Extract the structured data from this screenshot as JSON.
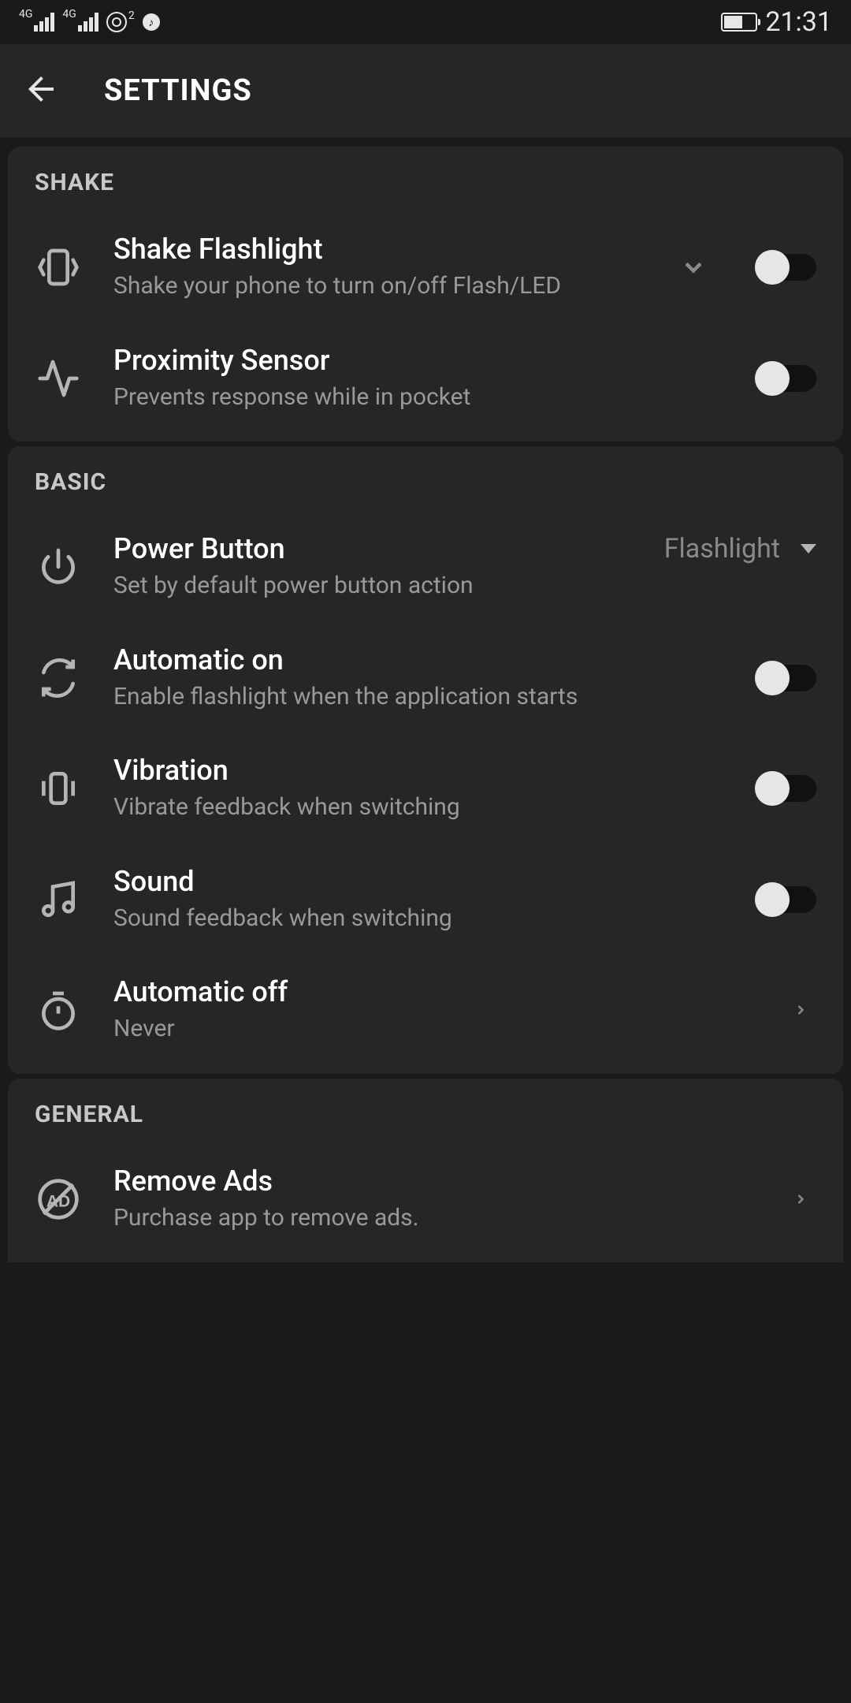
{
  "status": {
    "net_label": "4G",
    "hotspot_count": "2",
    "time": "21:31"
  },
  "header": {
    "title": "SETTINGS"
  },
  "sections": {
    "shake": {
      "header": "SHAKE",
      "shake_flashlight": {
        "title": "Shake Flashlight",
        "sub": "Shake your phone to turn on/off Flash/LED"
      },
      "proximity": {
        "title": "Proximity Sensor",
        "sub": "Prevents response while in pocket"
      }
    },
    "basic": {
      "header": "BASIC",
      "power_button": {
        "title": "Power Button",
        "value": "Flashlight",
        "sub": "Set by default power button action"
      },
      "auto_on": {
        "title": "Automatic on",
        "sub": "Enable flashlight when the application starts"
      },
      "vibration": {
        "title": "Vibration",
        "sub": "Vibrate feedback when switching"
      },
      "sound": {
        "title": "Sound",
        "sub": "Sound feedback when switching"
      },
      "auto_off": {
        "title": "Automatic off",
        "sub": "Never"
      }
    },
    "general": {
      "header": "GENERAL",
      "remove_ads": {
        "title": "Remove Ads",
        "sub": "Purchase app to remove ads."
      }
    }
  }
}
